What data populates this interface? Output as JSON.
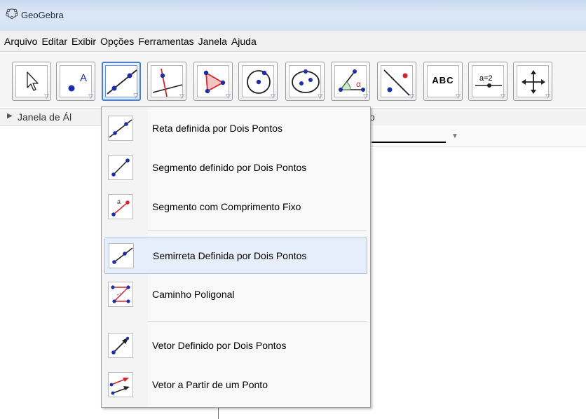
{
  "window": {
    "title": "GeoGebra"
  },
  "menu": [
    "Arquivo",
    "Editar",
    "Exibir",
    "Opções",
    "Ferramentas",
    "Janela",
    "Ajuda"
  ],
  "toolbar": {
    "tools": [
      {
        "name": "move-tool",
        "icon": "cursor-arrow-icon"
      },
      {
        "name": "point-tool",
        "icon": "point-a-icon",
        "label": "A"
      },
      {
        "name": "line-tool",
        "icon": "line-through-two-points-icon",
        "active": true
      },
      {
        "name": "perpendicular-tool",
        "icon": "perpendicular-line-icon"
      },
      {
        "name": "polygon-tool",
        "icon": "polygon-icon"
      },
      {
        "name": "circle-tool",
        "icon": "circle-center-point-icon"
      },
      {
        "name": "conic-tool",
        "icon": "ellipse-icon"
      },
      {
        "name": "angle-tool",
        "icon": "angle-alpha-icon",
        "label": "α"
      },
      {
        "name": "reflect-tool",
        "icon": "reflect-about-line-icon"
      },
      {
        "name": "text-tool",
        "icon": "text-abc-icon",
        "label": "ABC"
      },
      {
        "name": "slider-tool",
        "icon": "slider-icon",
        "label": "a=2"
      },
      {
        "name": "move-view-tool",
        "icon": "move-graphics-view-icon"
      }
    ]
  },
  "algebra_panel": {
    "label": "Janela de Ál",
    "label_tail": "o"
  },
  "dropdown": {
    "items": [
      {
        "label": "Reta definida por Dois Pontos",
        "icon": "line-two-points-icon"
      },
      {
        "label": "Segmento definido por Dois Pontos",
        "icon": "segment-two-points-icon"
      },
      {
        "label": "Segmento com Comprimento Fixo",
        "icon": "segment-fixed-length-icon",
        "icon_label": "a"
      },
      {
        "label": "Semirreta Definida por Dois Pontos",
        "icon": "ray-two-points-icon",
        "highlighted": true
      },
      {
        "label": "Caminho Poligonal",
        "icon": "polyline-icon"
      },
      {
        "label": "Vetor Definido por Dois Pontos",
        "icon": "vector-two-points-icon"
      },
      {
        "label": "Vetor a Partir de um Ponto",
        "icon": "vector-from-point-icon"
      }
    ]
  },
  "colors": {
    "point_blue": "#1d2fa8",
    "accent_red": "#d6252a",
    "highlight": "#e6eefb"
  }
}
